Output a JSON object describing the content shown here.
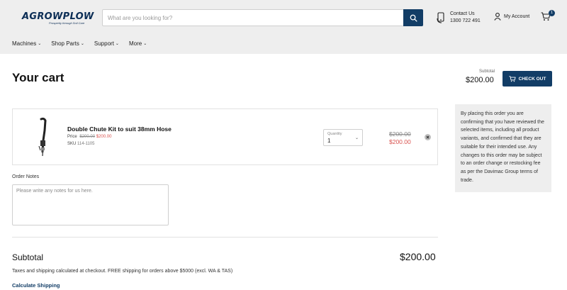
{
  "header": {
    "logo_text": "AGROWPLOW",
    "logo_tagline": "Prosperity through Soil Care",
    "search_placeholder": "What are you looking for?",
    "contact_label": "Contact Us",
    "contact_phone": "1300 722 491",
    "account_label": "My Account",
    "cart_count": "1"
  },
  "nav": {
    "items": [
      {
        "label": "Machines"
      },
      {
        "label": "Shop Parts"
      },
      {
        "label": "Support"
      },
      {
        "label": "More"
      }
    ]
  },
  "cart": {
    "title": "Your cart",
    "subtotal_label_top": "Subtotal",
    "subtotal_value_top": "$200.00",
    "checkout_label": "CHECK OUT",
    "item": {
      "name": "Double Chute Kit to suit 38mm Hose",
      "price_label": "Price",
      "price_old": "$200.00",
      "price_new": "$200.00",
      "sku_label": "SKU",
      "sku_value": "114-1105",
      "qty_label": "Quantity",
      "qty_value": "1",
      "line_old": "$200.00",
      "line_new": "$200.00"
    },
    "notes_label": "Order Notes",
    "notes_placeholder": "Please write any notes for us here.",
    "subtotal_label": "Subtotal",
    "subtotal_value": "$200.00",
    "tax_note": "Taxes and shipping calculated at checkout. FREE shipping for orders above $5000 (excl. WA & TAS)",
    "calc_shipping": "Calculate Shipping"
  },
  "side_note": "By placing this order you are confirming that you have reviewed the selected items, including all product variants, and confirmed that they are suitable for their intended use. Any changes to this order may be subject to an order change or restocking fee as per the Davimac Group terms of trade.",
  "colors": {
    "brand": "#123d66",
    "sale": "#d9534f",
    "header_bg": "#eeeeee"
  }
}
